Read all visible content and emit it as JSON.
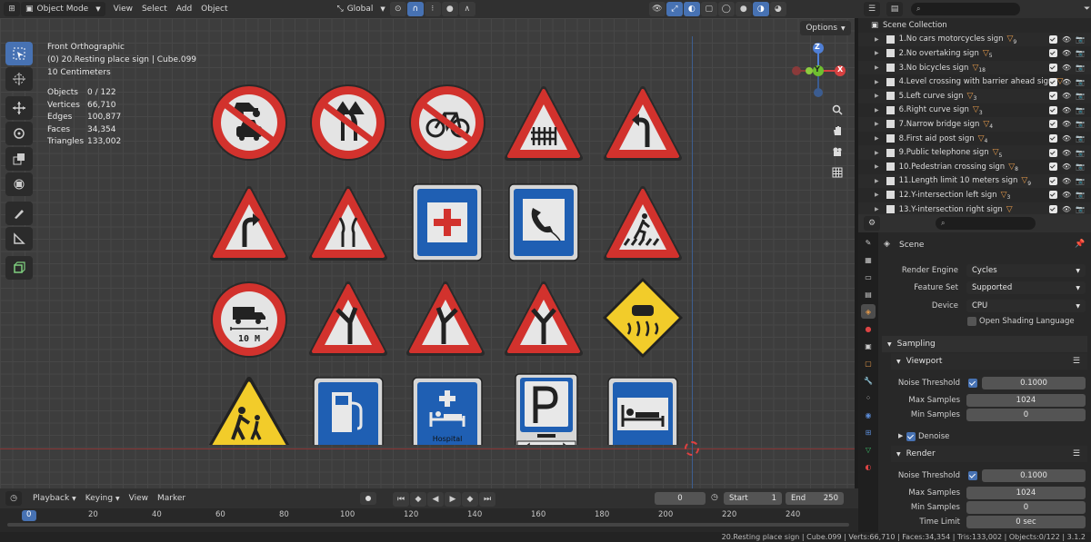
{
  "header": {
    "mode": "Object Mode",
    "menus": [
      "View",
      "Select",
      "Add",
      "Object"
    ],
    "orientation": "Global"
  },
  "viewport": {
    "view_name": "Front Orthographic",
    "active": "(0) 20.Resting place sign | Cube.099",
    "scale": "10 Centimeters",
    "options_label": "Options",
    "stats": [
      {
        "label": "Objects",
        "value": "0 / 122"
      },
      {
        "label": "Vertices",
        "value": "66,710"
      },
      {
        "label": "Edges",
        "value": "100,877"
      },
      {
        "label": "Faces",
        "value": "34,354"
      },
      {
        "label": "Triangles",
        "value": "133,002"
      }
    ],
    "gizmo": {
      "z": "Z",
      "y": "Y",
      "x": "X"
    },
    "sign_texts": {
      "length": "10 M",
      "hospital": "Hospital"
    }
  },
  "outliner": {
    "root": "Scene Collection",
    "items": [
      {
        "label": "1.No cars motorcycles sign",
        "count": "9"
      },
      {
        "label": "2.No overtaking sign",
        "count": "5"
      },
      {
        "label": "3.No bicycles sign",
        "count": "18"
      },
      {
        "label": "4.Level crossing with barrier ahead sign",
        "count": ""
      },
      {
        "label": "5.Left curve sign",
        "count": "3"
      },
      {
        "label": "6.Right curve sign",
        "count": "3"
      },
      {
        "label": "7.Narrow bridge sign",
        "count": "4"
      },
      {
        "label": "8.First aid post sign",
        "count": "4"
      },
      {
        "label": "9.Public telephone sign",
        "count": "5"
      },
      {
        "label": "10.Pedestrian crossing sign",
        "count": "8"
      },
      {
        "label": "11.Length limit 10 meters sign",
        "count": "9"
      },
      {
        "label": "12.Y-intersection left sign",
        "count": "3"
      },
      {
        "label": "13.Y-intersection right sign",
        "count": ""
      }
    ]
  },
  "properties": {
    "context": "Scene",
    "render_engine": {
      "label": "Render Engine",
      "value": "Cycles"
    },
    "feature_set": {
      "label": "Feature Set",
      "value": "Supported"
    },
    "device": {
      "label": "Device",
      "value": "CPU"
    },
    "osl": "Open Shading Language",
    "sampling": "Sampling",
    "viewport": {
      "title": "Viewport",
      "noise_label": "Noise Threshold",
      "noise": "0.1000",
      "max_label": "Max Samples",
      "max": "1024",
      "min_label": "Min Samples",
      "min": "0"
    },
    "denoise": "Denoise",
    "render": {
      "title": "Render",
      "noise_label": "Noise Threshold",
      "noise": "0.1000",
      "max_label": "Max Samples",
      "max": "1024",
      "min_label": "Min Samples",
      "min": "0",
      "time_label": "Time Limit",
      "time": "0 sec"
    }
  },
  "timeline": {
    "menus": [
      "Playback",
      "Keying",
      "View",
      "Marker"
    ],
    "current": "0",
    "start_label": "Start",
    "start": "1",
    "end_label": "End",
    "end": "250",
    "ticks": [
      "0",
      "20",
      "40",
      "60",
      "80",
      "100",
      "120",
      "140",
      "160",
      "180",
      "200",
      "220",
      "240"
    ]
  },
  "status": "20.Resting place sign | Cube.099 | Verts:66,710 | Faces:34,354 | Tris:133,002 | Objects:0/122 | 3.1.2",
  "colors": {
    "accent": "#4772b3",
    "sign_red": "#d2322d",
    "sign_blue": "#1f5fb3",
    "sign_yellow": "#f2cc2a"
  }
}
